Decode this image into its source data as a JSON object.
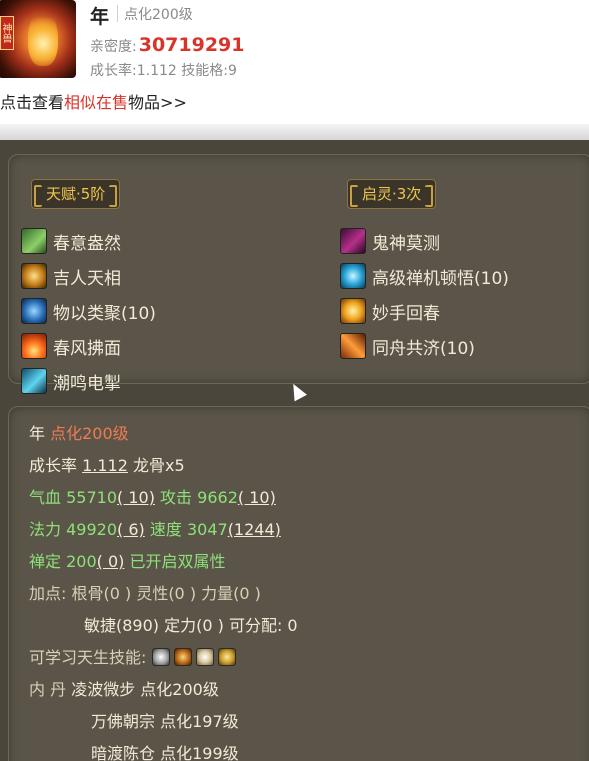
{
  "header": {
    "name": "年",
    "level": "点化200级",
    "avatar_badge": "神兽",
    "intimacy_label": "亲密度:",
    "intimacy_value": "30719291",
    "growth_skill_text": "成长率:1.112  技能格:9",
    "similar_prefix": "点击查看",
    "similar_link": "相似在售",
    "similar_suffix": "物品>>"
  },
  "talent": {
    "tag_left": "天赋·5阶",
    "tag_right": "启灵·3次",
    "left_items": [
      {
        "label": "春意盎然",
        "icon": "spring-green-icon"
      },
      {
        "label": "吉人天相",
        "icon": "golden-luck-icon"
      },
      {
        "label": "物以类聚(10)",
        "icon": "blue-orb-icon"
      },
      {
        "label": "春风拂面",
        "icon": "fire-wind-icon"
      },
      {
        "label": "潮鸣电掣",
        "icon": "tide-lightning-icon"
      }
    ],
    "right_items": [
      {
        "label": "鬼神莫测",
        "icon": "hidden-rune-icon"
      },
      {
        "label": "高级禅机顿悟(10)",
        "icon": "zen-rune-icon"
      },
      {
        "label": "妙手回春",
        "icon": "healing-hand-icon"
      },
      {
        "label": "同舟共济(10)",
        "icon": "shared-boat-icon"
      }
    ]
  },
  "stats": {
    "name": "年",
    "level": "点化200级",
    "growth_label": "成长率",
    "growth_value": "1.112",
    "dragon_bone": "龙骨x5",
    "hp_label": "气血",
    "hp_value": "55710",
    "hp_bonus": "( 10)",
    "atk_label": "攻击",
    "atk_value": "9662",
    "atk_bonus": "( 10)",
    "mp_label": "法力",
    "mp_value": "49920",
    "mp_bonus": "( 6)",
    "spd_label": "速度",
    "spd_value": "3047",
    "spd_bonus": "(1244)",
    "chan_label": "禅定",
    "chan_value": "200",
    "chan_bonus": "( 0)",
    "dual_attr": "已开启双属性",
    "points_line1": "加点:  根骨(0 ) 灵性(0 ) 力量(0 )",
    "points_line2": "敏捷(890) 定力(0 ) 可分配:  0",
    "innate_label": "可学习天生技能:",
    "innate_icons": [
      "silver-crest-icon",
      "golden-claw-icon",
      "white-cloud-icon",
      "golden-statue-icon"
    ],
    "neidan_label": "内    丹",
    "neidan": [
      "凌波微步  点化200级",
      "万佛朝宗  点化197级",
      "暗渡陈仓  点化199级"
    ]
  }
}
